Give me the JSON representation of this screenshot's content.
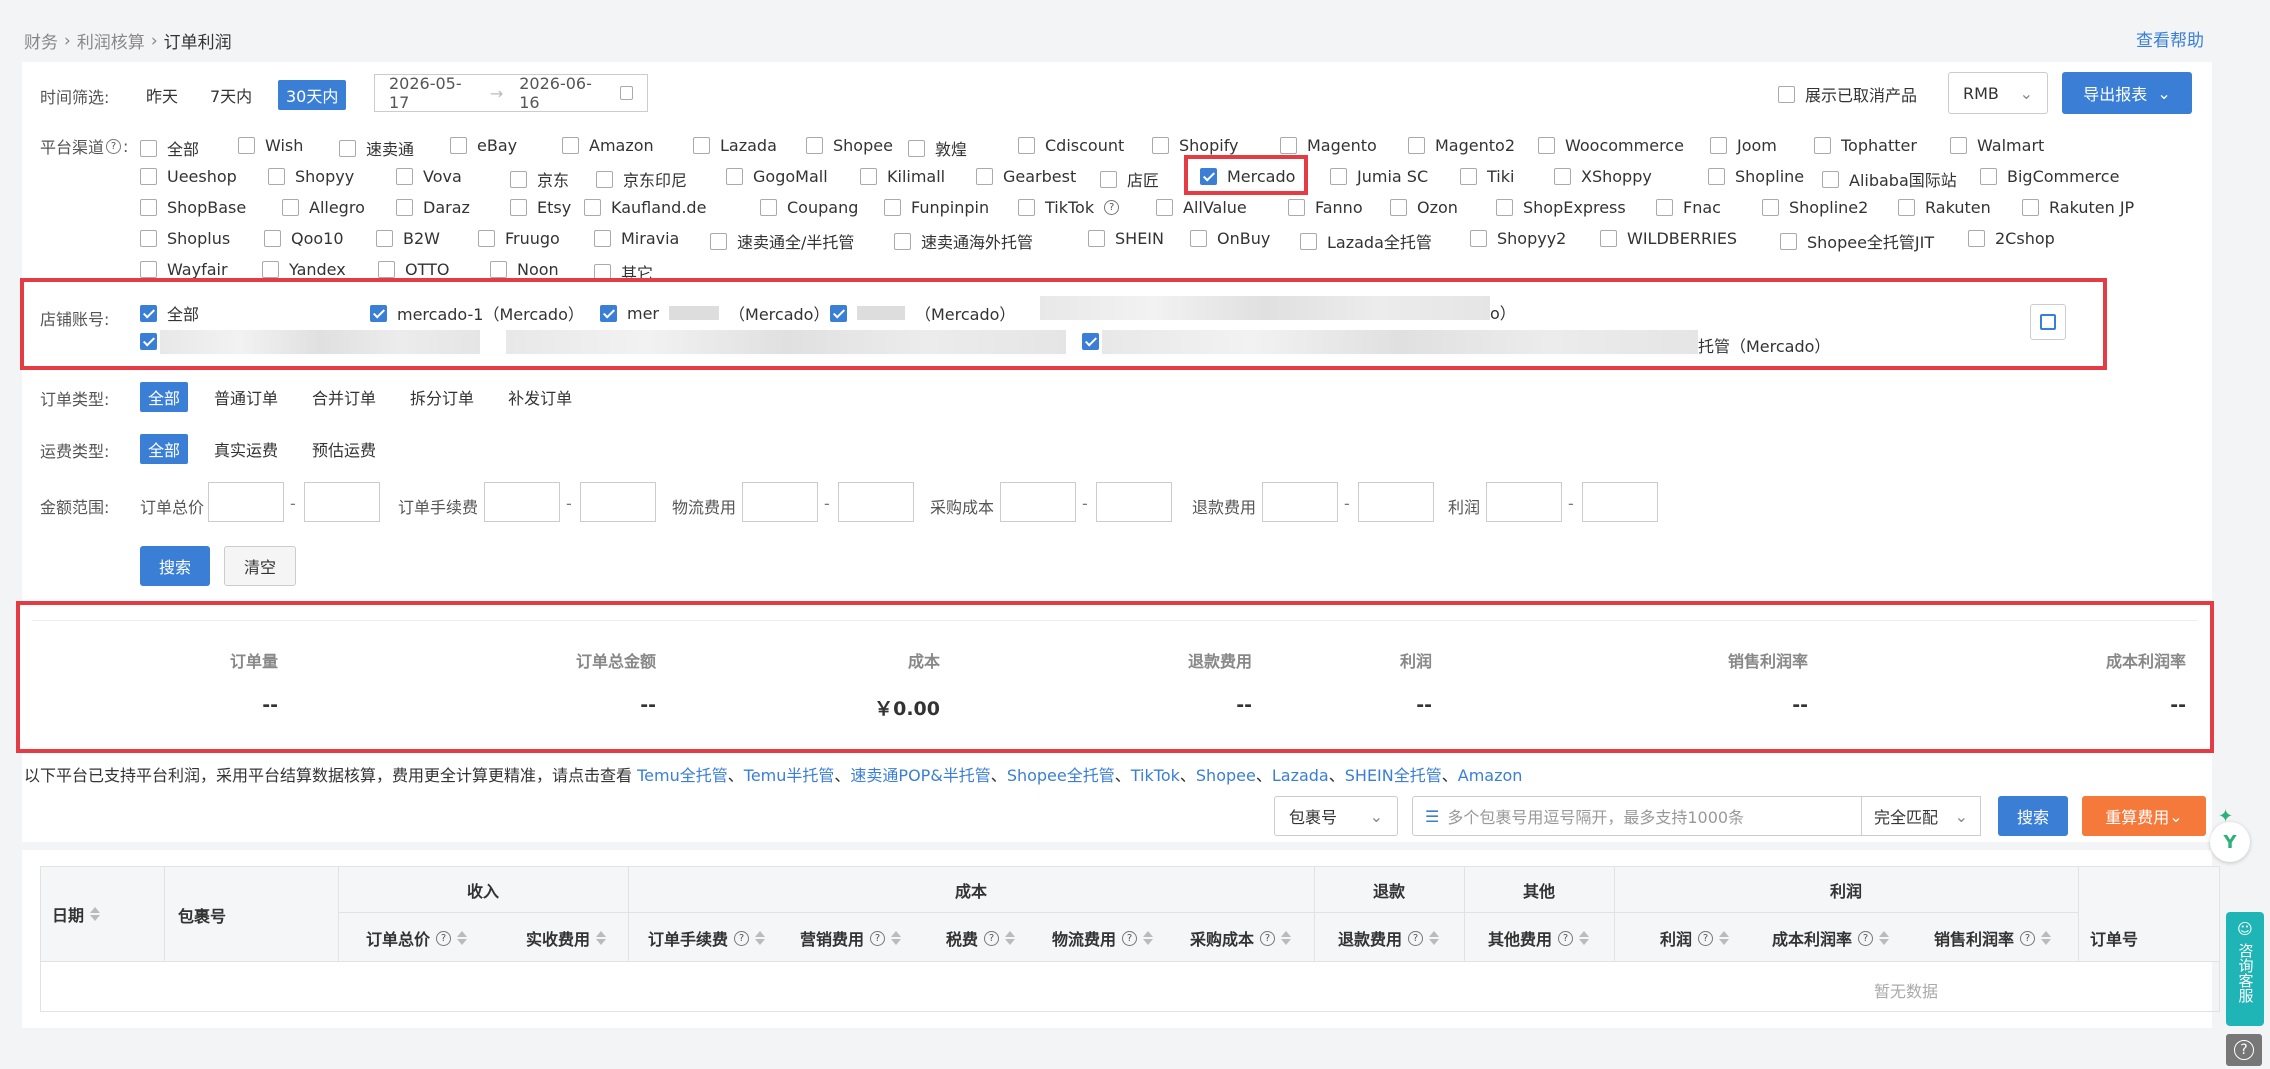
{
  "breadcrumb": [
    "财务",
    "利润核算",
    "订单利润"
  ],
  "help_link": "查看帮助",
  "time_filter": {
    "label": "时间筛选:",
    "options": [
      "昨天",
      "7天内",
      "30天内"
    ],
    "active": 2,
    "start_date": "2026-05-17",
    "end_date": "2026-06-16"
  },
  "show_cancelled": "展示已取消产品",
  "currency": "RMB",
  "export_button": "导出报表",
  "platform": {
    "label": "平台渠道",
    "rows": [
      [
        "全部",
        "Wish",
        "速卖通",
        "eBay",
        "Amazon",
        "Lazada",
        "Shopee",
        "敦煌",
        "Cdiscount",
        "Shopify",
        "Magento",
        "Magento2",
        "Woocommerce",
        "Joom",
        "Tophatter",
        "Walmart"
      ],
      [
        "Ueeshop",
        "Shopyy",
        "Vova",
        "京东",
        "京东印尼",
        "GogoMall",
        "Kilimall",
        "Gearbest",
        "店匠",
        "Mercado",
        "Jumia SC",
        "Tiki",
        "XShoppy",
        "Shopline",
        "Alibaba国际站",
        "BigCommerce"
      ],
      [
        "ShopBase",
        "Allegro",
        "Daraz",
        "Etsy",
        "Kaufland.de",
        "Coupang",
        "Funpinpin",
        "TikTok",
        "AllValue",
        "Fanno",
        "Ozon",
        "ShopExpress",
        "Fnac",
        "Shopline2",
        "Rakuten",
        "Rakuten JP"
      ],
      [
        "Shoplus",
        "Qoo10",
        "B2W",
        "Fruugo",
        "Miravia",
        "速卖通全/半托管",
        "速卖通海外托管",
        "SHEIN",
        "OnBuy",
        "Lazada全托管",
        "Shopyy2",
        "WILDBERRIES",
        "Shopee全托管JIT",
        "2Cshop"
      ],
      [
        "Wayfair",
        "Yandex",
        "OTTO",
        "Noon",
        "其它"
      ]
    ],
    "checked": "Mercado"
  },
  "store": {
    "label": "店铺账号:",
    "all": "全部",
    "items": [
      "mercado-1（Mercado）",
      "mer",
      "（Mercado）",
      "（Mercado）",
      "o）",
      "托管（Mercado）"
    ]
  },
  "order_type": {
    "label": "订单类型:",
    "options": [
      "全部",
      "普通订单",
      "合并订单",
      "拆分订单",
      "补发订单"
    ]
  },
  "freight_type": {
    "label": "运费类型:",
    "options": [
      "全部",
      "真实运费",
      "预估运费"
    ]
  },
  "amount": {
    "label": "金额范围:",
    "fields": [
      "订单总价",
      "订单手续费",
      "物流费用",
      "采购成本",
      "退款费用",
      "利润"
    ],
    "sep": "-"
  },
  "search_button": "搜索",
  "clear_button": "清空",
  "stats": [
    {
      "label": "订单量",
      "value": "--"
    },
    {
      "label": "订单总金额",
      "value": "--"
    },
    {
      "label": "成本",
      "value": "￥0.00"
    },
    {
      "label": "退款费用",
      "value": "--"
    },
    {
      "label": "利润",
      "value": "--"
    },
    {
      "label": "销售利润率",
      "value": "--"
    },
    {
      "label": "成本利润率",
      "value": "--"
    }
  ],
  "notice": {
    "text": "以下平台已支持平台利润，采用平台结算数据核算，费用更全计算更精准，请点击查看",
    "links": [
      "Temu全托管",
      "Temu半托管",
      "速卖通POP&半托管",
      "Shopee全托管",
      "TikTok",
      "Shopee",
      "Lazada",
      "SHEIN全托管",
      "Amazon"
    ],
    "sep": "、"
  },
  "search_bar": {
    "field": "包裹号",
    "placeholder": "多个包裹号用逗号隔开，最多支持1000条",
    "match": "完全匹配",
    "search": "搜索",
    "recalc": "重算费用"
  },
  "table": {
    "groups": [
      "收入",
      "成本",
      "退款",
      "其他",
      "利润"
    ],
    "col_date": "日期",
    "col_pkg": "包裹号",
    "cols": [
      "订单总价",
      "实收费用",
      "订单手续费",
      "营销费用",
      "税费",
      "物流费用",
      "采购成本",
      "退款费用",
      "其他费用",
      "利润",
      "成本利润率",
      "销售利润率",
      "订单号"
    ],
    "empty": "暂无数据"
  },
  "side": {
    "consult": "咨询客服"
  },
  "colors": {
    "primary": "#3a7fd5",
    "red": "#e53b44",
    "orange": "#f5793a"
  }
}
